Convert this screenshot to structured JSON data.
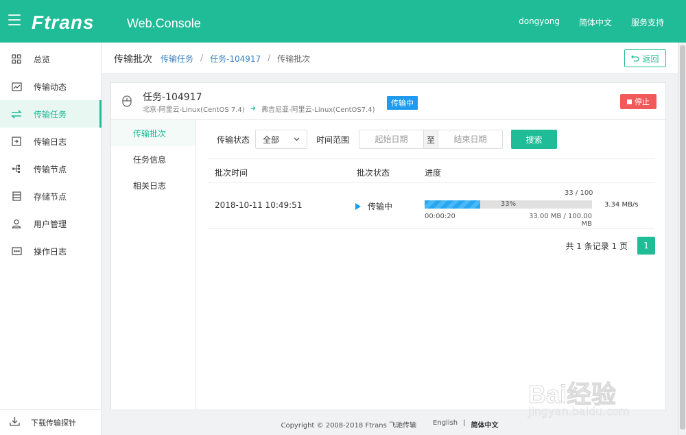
{
  "header": {
    "logo": "Ftrans",
    "product": "Web.Console",
    "user": "dongyong",
    "language": "简体中文",
    "support": "服务支持"
  },
  "sidebar": {
    "items": [
      {
        "label": "总览",
        "icon": "grid-icon"
      },
      {
        "label": "传输动态",
        "icon": "chart-icon"
      },
      {
        "label": "传输任务",
        "icon": "transfer-icon",
        "active": true
      },
      {
        "label": "传输日志",
        "icon": "log-in-icon"
      },
      {
        "label": "传输节点",
        "icon": "node-icon"
      },
      {
        "label": "存储节点",
        "icon": "storage-icon"
      },
      {
        "label": "用户管理",
        "icon": "user-icon"
      },
      {
        "label": "操作日志",
        "icon": "ops-log-icon"
      }
    ],
    "bottom": {
      "label": "下载传输探针",
      "icon": "download-icon"
    }
  },
  "page": {
    "title": "传输批次",
    "breadcrumb": [
      "传输任务",
      "任务-104917",
      "传输批次"
    ],
    "back_label": "返回"
  },
  "task": {
    "name": "任务-104917",
    "source": "北京-阿里云-Linux(CentOS 7.4)",
    "target": "弗吉尼亚-阿里云-Linux(CentOS7.4)",
    "status": "传输中",
    "stop_label": "停止"
  },
  "subnav": [
    "传输批次",
    "任务信息",
    "相关日志"
  ],
  "filters": {
    "status_label": "传输状态",
    "status_value": "全部",
    "range_label": "时间范围",
    "start_placeholder": "起始日期",
    "range_sep": "至",
    "end_placeholder": "结束日期",
    "search_label": "搜索"
  },
  "table": {
    "headers": [
      "批次时间",
      "批次状态",
      "进度"
    ],
    "rows": [
      {
        "time": "2018-10-11 10:49:51",
        "status": "传输中",
        "count": "33 / 100",
        "percent": "33%",
        "progress": 0.33,
        "elapsed": "00:00:20",
        "size": "33.00 MB / 100.00 MB",
        "speed": "3.34 MB/s"
      }
    ]
  },
  "pager": {
    "summary": "共 1 条记录 1 页",
    "current": "1"
  },
  "footer": {
    "copyright": "Copyright © 2008-2018 Ftrans 飞驰传输",
    "lang_en": "English",
    "lang_sep": "|",
    "lang_zh": "简体中文"
  },
  "watermark": {
    "text": "Bai经验",
    "sub": "jingyan.baidu.com"
  },
  "colors": {
    "brand": "#1fbc97",
    "status_blue": "#1e9bef",
    "stop_red": "#f25a5a"
  }
}
